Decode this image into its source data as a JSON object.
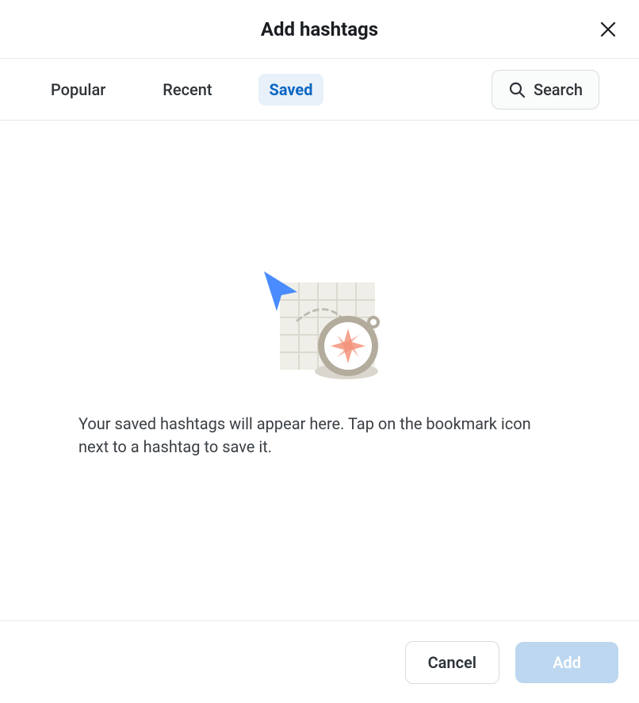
{
  "header": {
    "title": "Add hashtags"
  },
  "tabs": {
    "popular": "Popular",
    "recent": "Recent",
    "saved": "Saved",
    "active": "saved"
  },
  "search": {
    "label": "Search"
  },
  "empty_state": {
    "message": "Your saved hashtags will appear here. Tap on the bookmark icon next to a hashtag to save it."
  },
  "footer": {
    "cancel": "Cancel",
    "add": "Add"
  },
  "icons": {
    "close": "close-icon",
    "search": "search-icon",
    "illustration": "compass-map-illustration"
  }
}
